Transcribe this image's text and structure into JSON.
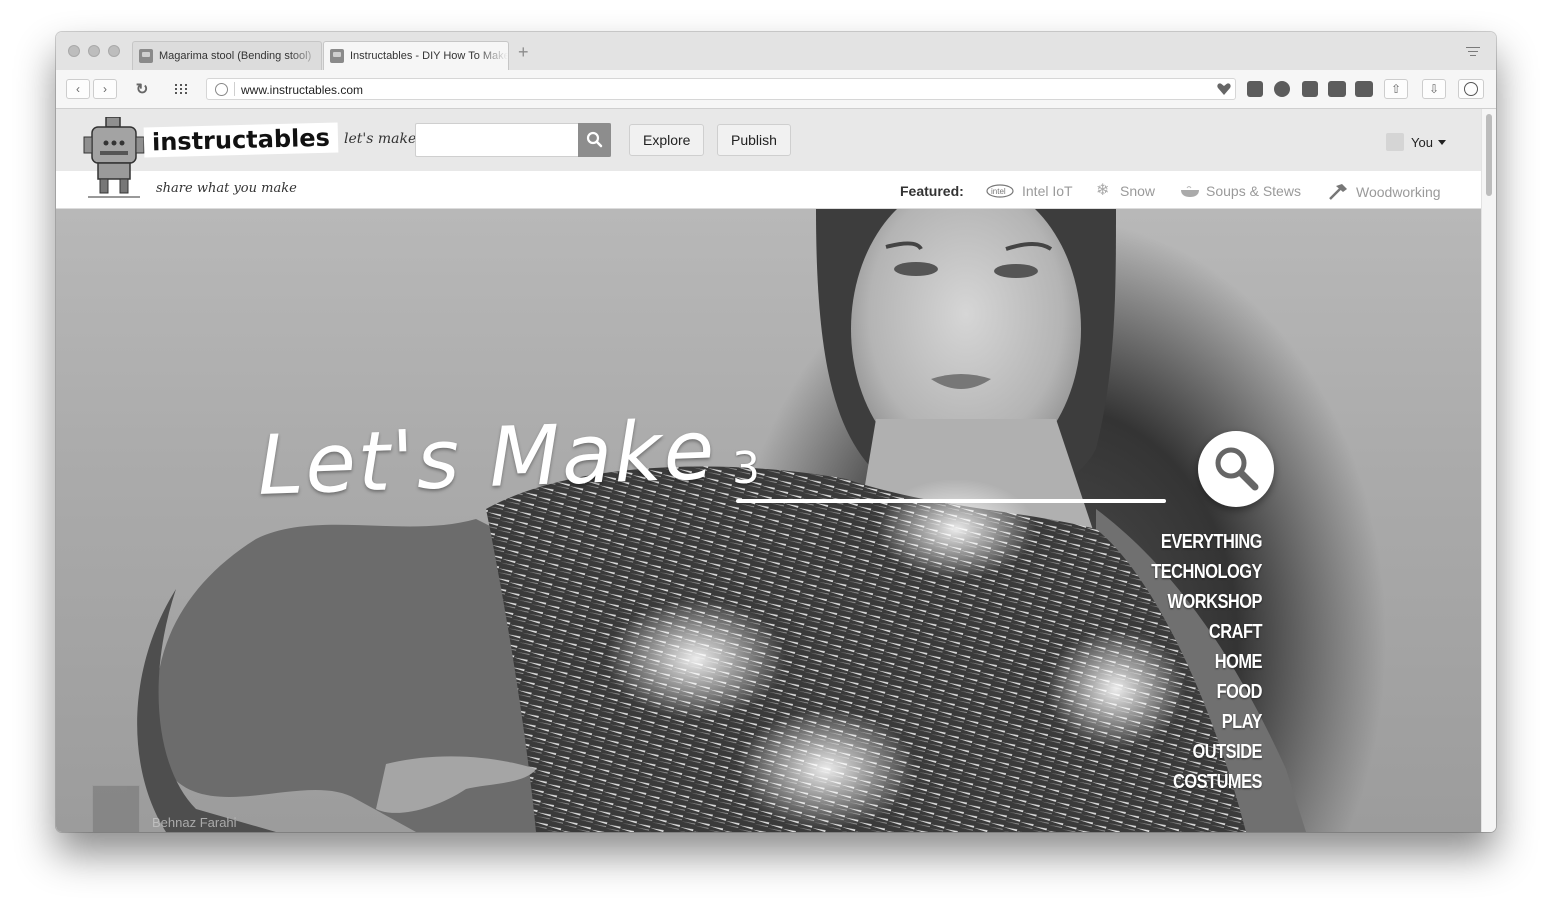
{
  "browser": {
    "tabs": [
      {
        "title": "Magarima stool (Bending stool)",
        "active": false
      },
      {
        "title": "Instructables - DIY How To Make",
        "active": true
      }
    ],
    "new_tab_icon": "plus-icon",
    "url": "www.instructables.com",
    "extension_icons": [
      "heart-icon",
      "lock-badge-icon",
      "wordpress-icon",
      "shield-icon",
      "glasses-icon",
      "css-icon",
      "share-icon",
      "download-icon",
      "account-icon"
    ]
  },
  "site": {
    "logo_text": "instructables",
    "tagline": "share what you make",
    "search_label": "let's make",
    "search_placeholder": "",
    "nav": {
      "explore": "Explore",
      "publish": "Publish"
    },
    "user_label": "You",
    "featured_label": "Featured:",
    "featured": [
      {
        "label": "Intel IoT",
        "icon": "intel-logo-icon"
      },
      {
        "label": "Snow",
        "icon": "snowflake-icon"
      },
      {
        "label": "Soups & Stews",
        "icon": "bowl-icon"
      },
      {
        "label": "Woodworking",
        "icon": "hammer-icon"
      }
    ]
  },
  "hero": {
    "title": "Let's Make",
    "search_value": "3",
    "categories": [
      "EVERYTHING",
      "TECHNOLOGY",
      "WORKSHOP",
      "CRAFT",
      "HOME",
      "FOOD",
      "PLAY",
      "OUTSIDE",
      "COSTUMES"
    ],
    "credit_name": "Behnaz Farahi"
  }
}
